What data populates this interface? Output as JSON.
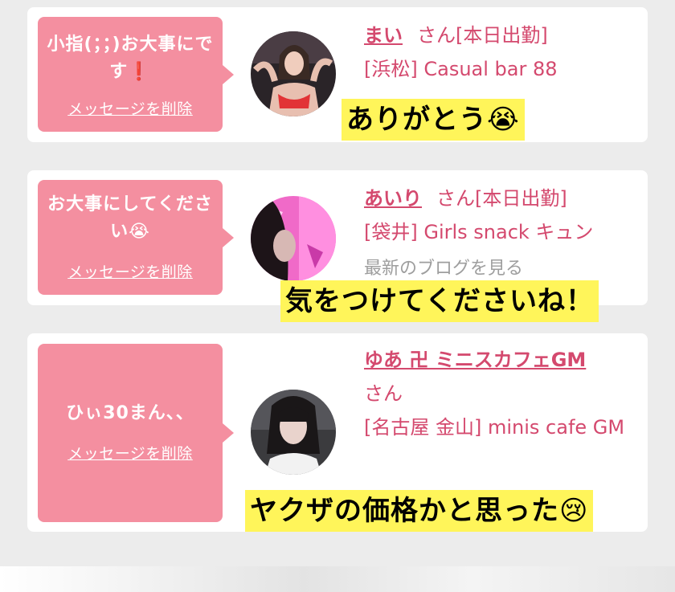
{
  "colors": {
    "accent": "#d4496e",
    "bubble": "#f48fa0",
    "caption_bg": "#fff55a",
    "page_bg": "#ececec"
  },
  "cards": [
    {
      "message": "小指(；；)お大事にです❗️",
      "delete_label": "メッセージを削除",
      "name": "まい",
      "honorific": "さん[本日出勤]",
      "shop": "[浜松] Casual bar 88",
      "blog": "",
      "caption": "ありがとう😭"
    },
    {
      "message": "お大事にしてください😭",
      "delete_label": "メッセージを削除",
      "name": "あいり",
      "honorific": "さん[本日出勤]",
      "shop": "[袋井] Girls snack キュン",
      "blog": "最新のブログを見る",
      "caption": "気をつけてくださいね！"
    },
    {
      "message": "ひぃ30まん、、",
      "delete_label": "メッセージを削除",
      "name": "ゆあ 卍 ミニスカフェGM",
      "honorific": "さん",
      "shop": "[名古屋 金山] minis cafe GM",
      "blog": "",
      "caption": "ヤクザの価格かと思った😢"
    }
  ]
}
